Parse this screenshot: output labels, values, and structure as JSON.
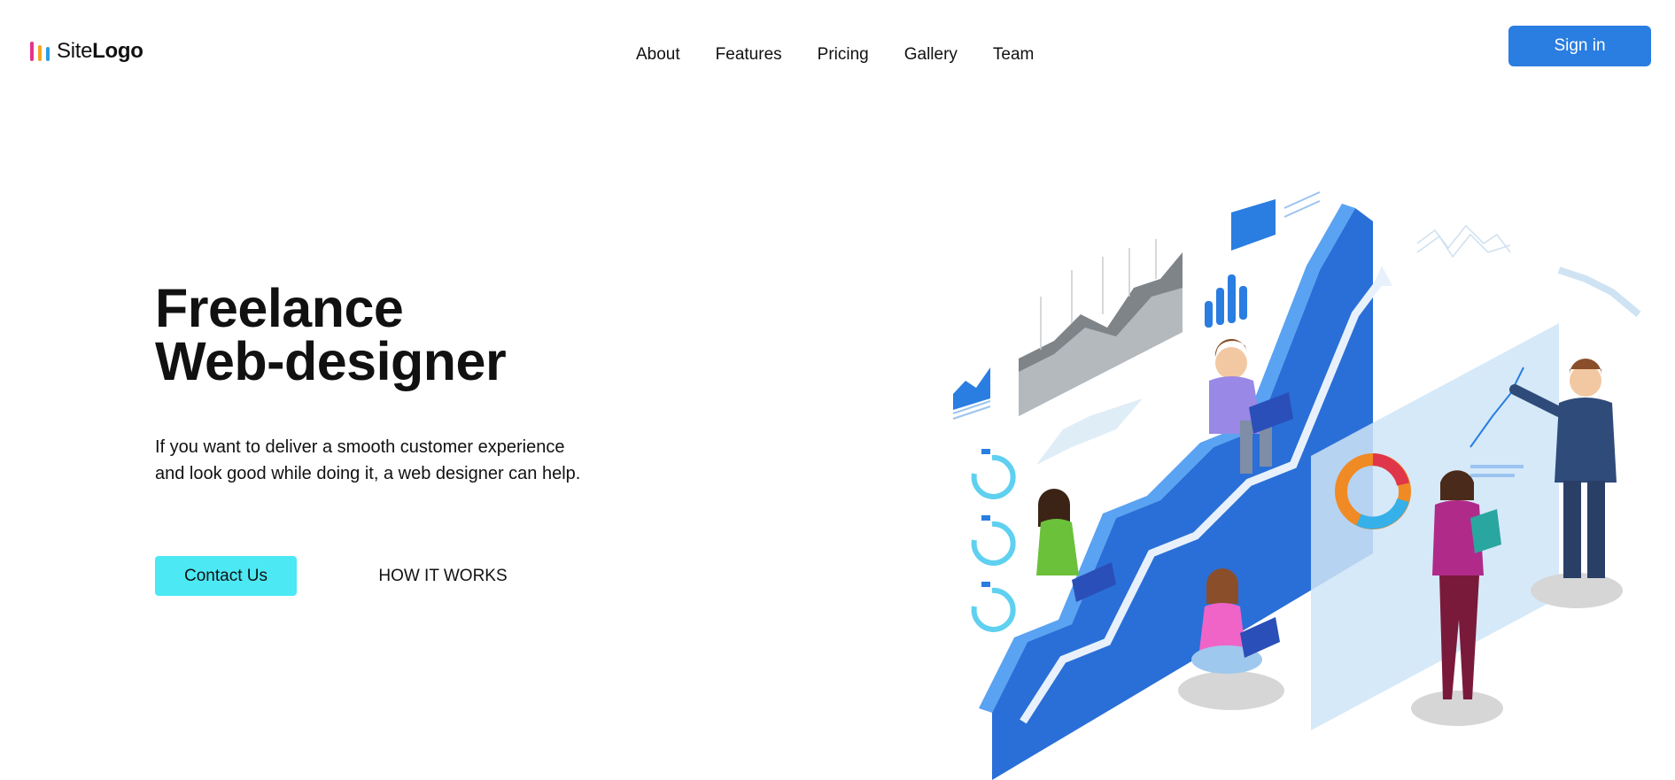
{
  "header": {
    "logo": {
      "light": "Site",
      "bold": "Logo",
      "bar_colors": [
        "#e6338c",
        "#f6a623",
        "#2a9fe8"
      ]
    },
    "nav": [
      {
        "label": "About"
      },
      {
        "label": "Features"
      },
      {
        "label": "Pricing"
      },
      {
        "label": "Gallery"
      },
      {
        "label": "Team"
      }
    ],
    "signin_label": "Sign in"
  },
  "hero": {
    "title_line1": "Freelance",
    "title_line2": "Web-designer",
    "text_line1": "If you want to deliver a smooth customer experience",
    "text_line2": "and look good while doing it, a web designer can help.",
    "contact_label": "Contact Us",
    "how_label": "HOW IT WORKS"
  },
  "colors": {
    "accent": "#2a7de1",
    "contact_button": "#4ce8f4"
  }
}
